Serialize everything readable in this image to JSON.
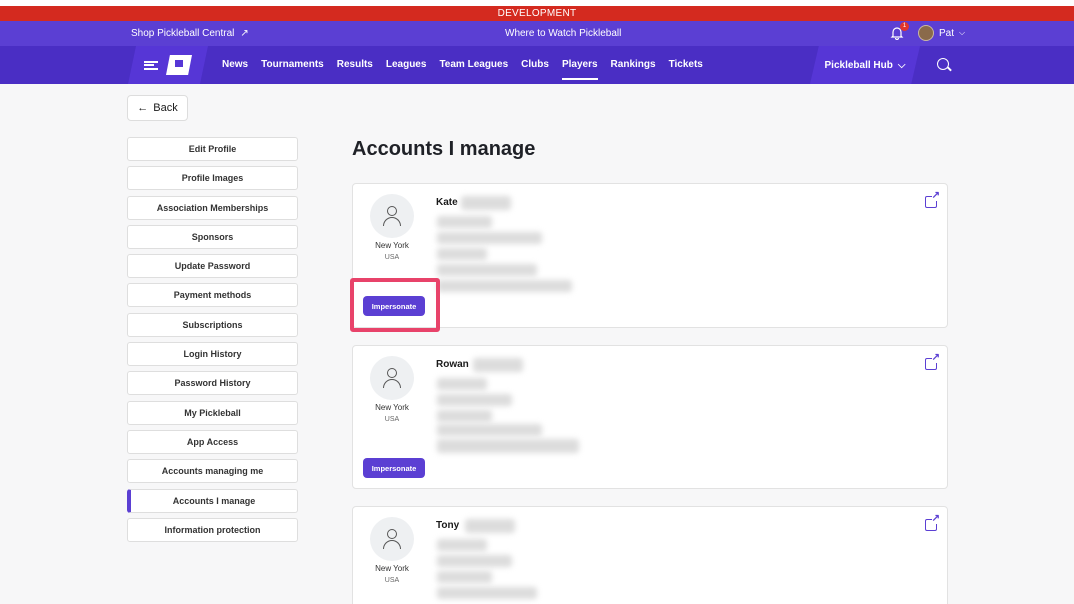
{
  "dev_banner": "DEVELOPMENT",
  "util_bar": {
    "shop_label": "Shop Pickleball Central",
    "where_label": "Where to Watch Pickleball",
    "notification_count": "1",
    "user_name": "Pat"
  },
  "nav": {
    "items": [
      "News",
      "Tournaments",
      "Results",
      "Leagues",
      "Team Leagues",
      "Clubs",
      "Players",
      "Rankings",
      "Tickets"
    ],
    "active": "Players",
    "hub_label": "Pickleball Hub"
  },
  "back_label": "Back",
  "sidebar": {
    "items": [
      "Edit Profile",
      "Profile Images",
      "Association Memberships",
      "Sponsors",
      "Update Password",
      "Payment methods",
      "Subscriptions",
      "Login History",
      "Password History",
      "My Pickleball",
      "App Access",
      "Accounts managing me",
      "Accounts I manage",
      "Information protection"
    ],
    "active": "Accounts I manage"
  },
  "page_title": "Accounts I manage",
  "accounts": [
    {
      "first_name": "Kate",
      "city": "New York",
      "country": "USA",
      "button": "Impersonate"
    },
    {
      "first_name": "Rowan",
      "city": "New York",
      "country": "USA",
      "button": "Impersonate"
    },
    {
      "first_name": "Tony",
      "city": "New York",
      "country": "USA",
      "button": ""
    }
  ],
  "icons": {
    "external": "external-link-icon",
    "person": "person-icon",
    "bell": "bell-icon",
    "search": "search-icon"
  },
  "colors": {
    "brand": "#5b3fd3",
    "dev": "#d42a1f",
    "highlight": "#e8436a"
  }
}
